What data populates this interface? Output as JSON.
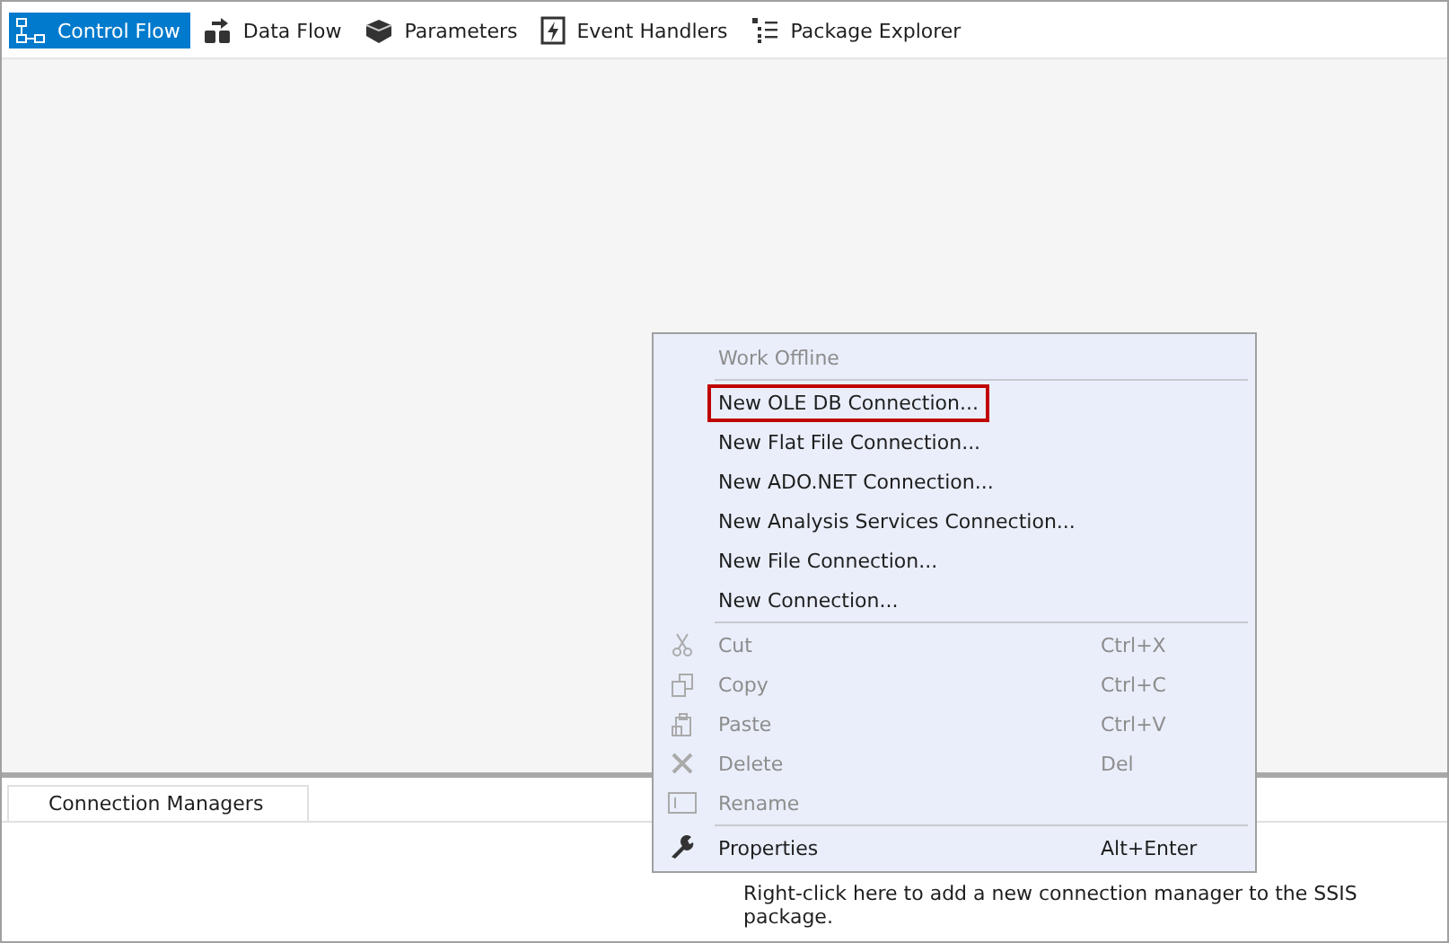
{
  "tabs": [
    {
      "label": "Control Flow",
      "selected": true
    },
    {
      "label": "Data Flow",
      "selected": false
    },
    {
      "label": "Parameters",
      "selected": false
    },
    {
      "label": "Event Handlers",
      "selected": false
    },
    {
      "label": "Package Explorer",
      "selected": false
    }
  ],
  "connection_managers": {
    "tab": "Connection Managers",
    "hint": "Right-click here to add a new connection manager to the SSIS package."
  },
  "context_menu": [
    {
      "kind": "item",
      "label": "Work Offline",
      "disabled": true,
      "highlighted": false
    },
    {
      "kind": "separator"
    },
    {
      "kind": "item",
      "label": "New OLE DB Connection...",
      "disabled": false,
      "highlighted": true
    },
    {
      "kind": "item",
      "label": "New Flat File Connection...",
      "disabled": false,
      "highlighted": false
    },
    {
      "kind": "item",
      "label": "New ADO.NET Connection...",
      "disabled": false,
      "highlighted": false
    },
    {
      "kind": "item",
      "label": "New Analysis Services Connection...",
      "disabled": false,
      "highlighted": false
    },
    {
      "kind": "item",
      "label": "New File Connection...",
      "disabled": false,
      "highlighted": false
    },
    {
      "kind": "item",
      "label": "New Connection...",
      "disabled": false,
      "highlighted": false
    },
    {
      "kind": "separator"
    },
    {
      "kind": "item",
      "label": "Cut",
      "shortcut": "Ctrl+X",
      "disabled": true,
      "highlighted": false
    },
    {
      "kind": "item",
      "label": "Copy",
      "shortcut": "Ctrl+C",
      "disabled": true,
      "highlighted": false
    },
    {
      "kind": "item",
      "label": "Paste",
      "shortcut": "Ctrl+V",
      "disabled": true,
      "highlighted": false
    },
    {
      "kind": "item",
      "label": "Delete",
      "shortcut": "Del",
      "disabled": true,
      "highlighted": false
    },
    {
      "kind": "item",
      "label": "Rename",
      "disabled": true,
      "highlighted": false
    },
    {
      "kind": "separator"
    },
    {
      "kind": "item",
      "label": "Properties",
      "shortcut": "Alt+Enter",
      "disabled": false,
      "highlighted": false
    }
  ]
}
